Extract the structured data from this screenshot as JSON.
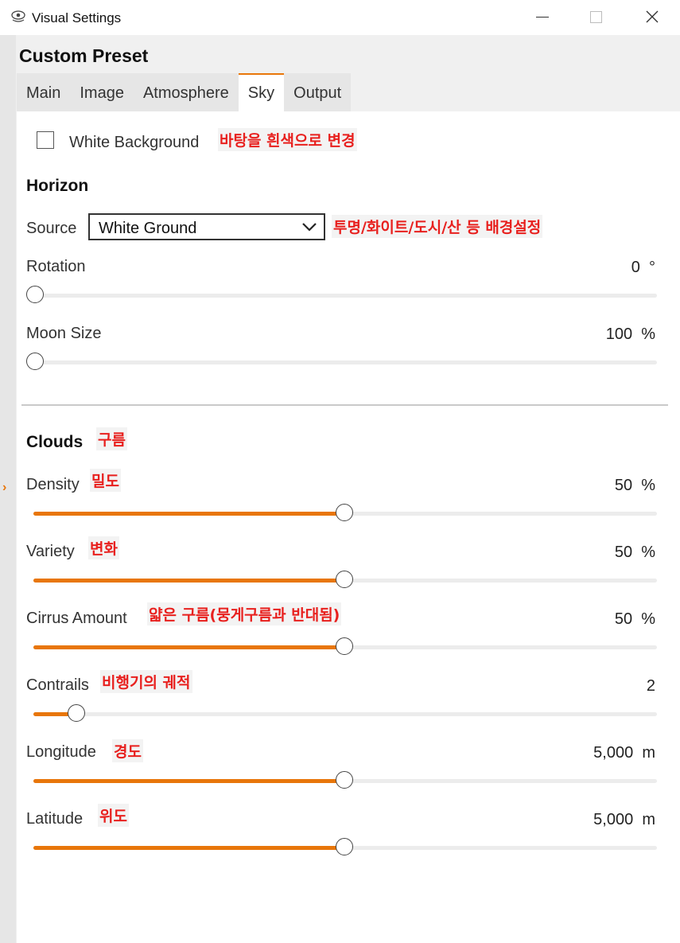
{
  "window": {
    "title": "Visual Settings",
    "icon": "eye-icon"
  },
  "preset_title": "Custom Preset",
  "tabs": [
    {
      "label": "Main",
      "active": false
    },
    {
      "label": "Image",
      "active": false
    },
    {
      "label": "Atmosphere",
      "active": false
    },
    {
      "label": "Sky",
      "active": true
    },
    {
      "label": "Output",
      "active": false
    }
  ],
  "colors": {
    "accent": "#e8760a",
    "annotation": "#e8201e"
  },
  "white_background": {
    "label": "White Background",
    "checked": false,
    "note": "바탕을 흰색으로 변경"
  },
  "horizon": {
    "heading": "Horizon",
    "source": {
      "label": "Source",
      "value": "White Ground",
      "note": "투명/화이트/도시/산 등 배경설정"
    },
    "rotation": {
      "label": "Rotation",
      "value": "0",
      "unit": "°",
      "fraction": 0.0
    },
    "moon_size": {
      "label": "Moon Size",
      "value": "100",
      "unit": "%",
      "fraction": 0.0
    }
  },
  "clouds": {
    "heading": "Clouds",
    "heading_note": "구름",
    "density": {
      "label": "Density",
      "value": "50",
      "unit": "%",
      "fraction": 0.5,
      "note": "밀도"
    },
    "variety": {
      "label": "Variety",
      "value": "50",
      "unit": "%",
      "fraction": 0.5,
      "note": "변화"
    },
    "cirrus": {
      "label": "Cirrus Amount",
      "value": "50",
      "unit": "%",
      "fraction": 0.5,
      "note": "얇은 구름(뭉게구름과 반대됨)"
    },
    "contrails": {
      "label": "Contrails",
      "value": "2",
      "unit": "",
      "fraction": 0.07,
      "note": "비행기의 궤적"
    },
    "longitude": {
      "label": "Longitude",
      "value": "5,000",
      "unit": "m",
      "fraction": 0.5,
      "note": "경도"
    },
    "latitude": {
      "label": "Latitude",
      "value": "5,000",
      "unit": "m",
      "fraction": 0.5,
      "note": "위도"
    }
  }
}
